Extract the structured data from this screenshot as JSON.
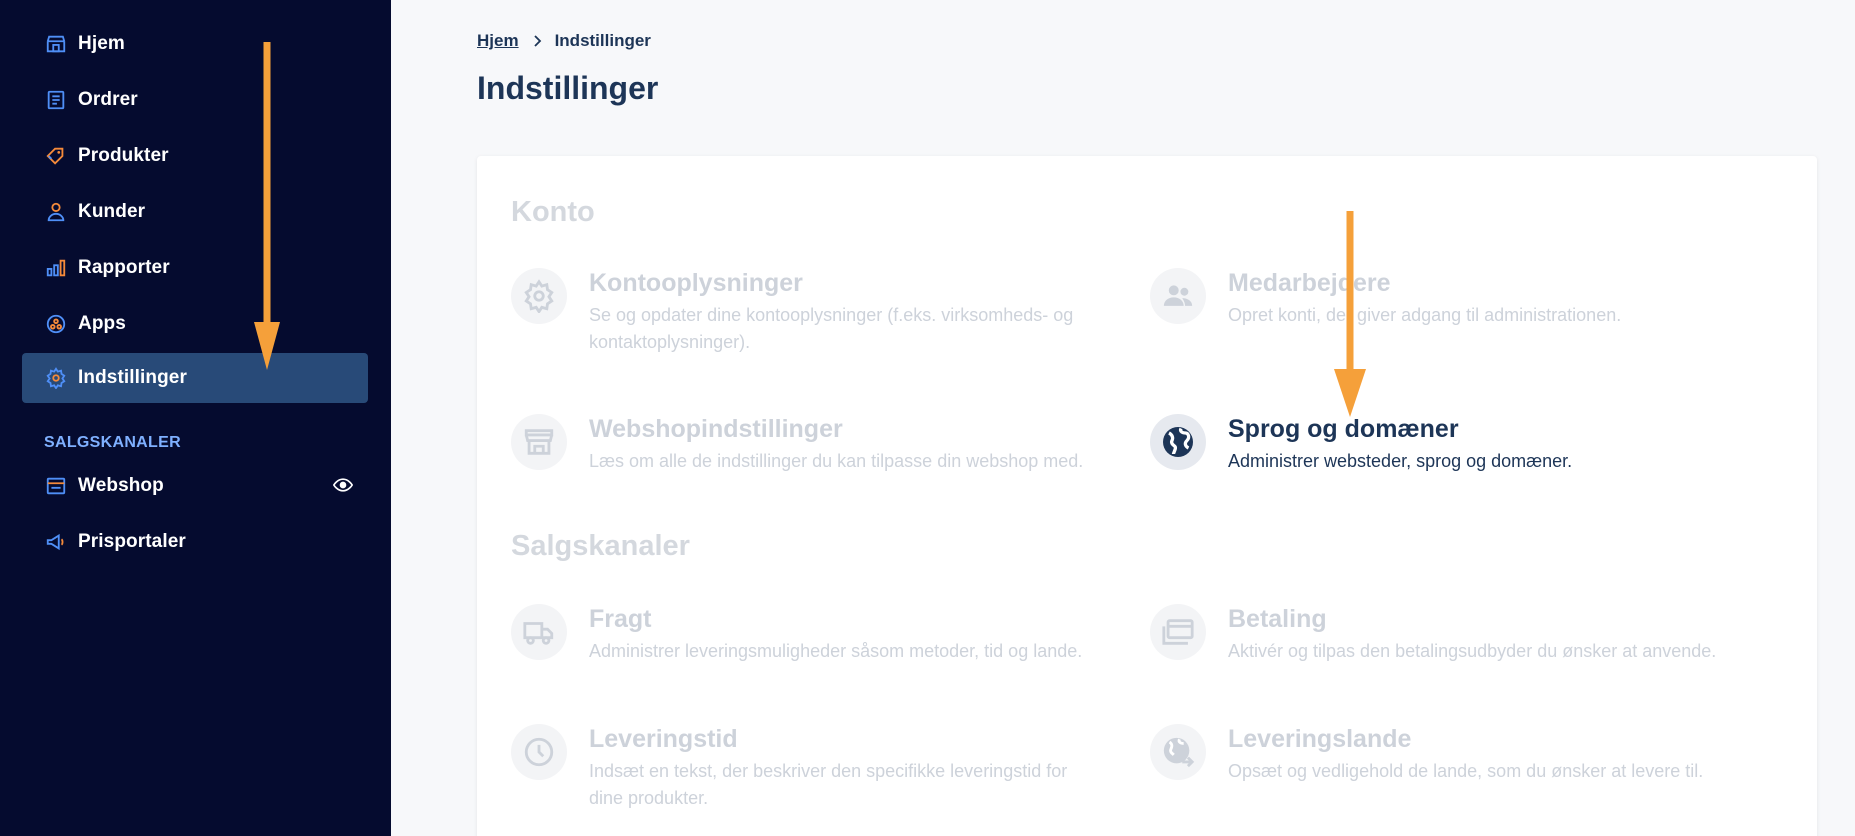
{
  "sidebar": {
    "items": [
      {
        "label": "Hjem",
        "icon": "store-icon"
      },
      {
        "label": "Ordrer",
        "icon": "orders-icon"
      },
      {
        "label": "Produkter",
        "icon": "tag-icon"
      },
      {
        "label": "Kunder",
        "icon": "person-icon"
      },
      {
        "label": "Rapporter",
        "icon": "bar-chart-icon"
      },
      {
        "label": "Apps",
        "icon": "apps-icon"
      },
      {
        "label": "Indstillinger",
        "icon": "gear-icon",
        "active": true
      }
    ],
    "section_label": "SALGSKANALER",
    "channels": [
      {
        "label": "Webshop",
        "icon": "browser-icon"
      },
      {
        "label": "Prisportaler",
        "icon": "megaphone-icon"
      }
    ]
  },
  "breadcrumb": {
    "home": "Hjem",
    "current": "Indstillinger"
  },
  "page_title": "Indstillinger",
  "groups": {
    "konto": {
      "title": "Konto",
      "items": [
        {
          "title": "Kontooplysninger",
          "desc_line1": "Se og opdater dine kontooplysninger (f.eks. virksomheds- og",
          "desc_line2": "kontaktoplysninger).",
          "icon": "gear-icon"
        },
        {
          "title": "Medarbejdere",
          "desc_line1": "Opret konti, der giver adgang til administrationen.",
          "icon": "users-icon"
        },
        {
          "title": "Webshopindstillinger",
          "desc_line1": "Læs om alle de indstillinger du kan tilpasse din webshop med.",
          "icon": "storefront-icon"
        },
        {
          "title": "Sprog og domæner",
          "desc_line1": "Administrer websteder, sprog og domæner.",
          "icon": "globe-icon"
        }
      ]
    },
    "salgskanaler": {
      "title": "Salgskanaler",
      "items": [
        {
          "title": "Fragt",
          "desc_line1": "Administrer leveringsmuligheder såsom metoder, tid og lande.",
          "icon": "truck-icon"
        },
        {
          "title": "Betaling",
          "desc_line1": "Aktivér og tilpas den betalingsudbyder du ønsker at anvende.",
          "icon": "card-icon"
        },
        {
          "title": "Leveringstid",
          "desc_line1": "Indsæt en tekst, der beskriver den specifikke leveringstid for",
          "desc_line2": "dine produkter.",
          "icon": "clock-icon"
        },
        {
          "title": "Leveringslande",
          "desc_line1": "Opsæt og vedligehold de lande, som du ønsker at levere til.",
          "icon": "globe-arrow-icon"
        }
      ]
    }
  },
  "colors": {
    "sidebar_bg": "#050b2f",
    "active_bg": "#284a78",
    "accent_arrow": "#f5a03a",
    "title": "#1d3557",
    "muted": "#cdd2da"
  }
}
